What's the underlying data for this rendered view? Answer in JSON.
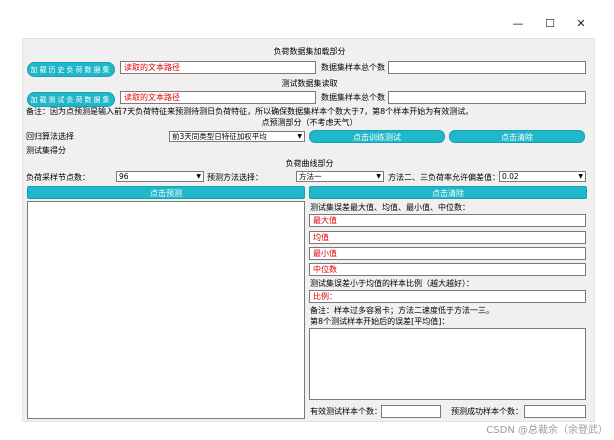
{
  "titlebar": {
    "minimize": "—",
    "maximize": "☐",
    "close": "✕"
  },
  "load_section": {
    "title": "负荷数据集加载部分",
    "load_history_button": "加载历史负荷数据集",
    "history_path": "读取的文本路径",
    "count_label": "数据集样本总个数",
    "count_value": ""
  },
  "test_section": {
    "title": "测试数据集读取",
    "load_test_button": "加载测试负荷数据集",
    "test_path": "读取的文本路径",
    "count_label": "数据集样本总个数",
    "count_value": ""
  },
  "note": "备注：因为点预测是输入前7天负荷特征来预测待测日负荷特征，所以确保数据集样本个数大于7，第8个样本开始为有效测试。",
  "point_section": {
    "title": "点预测部分（不考虑天气）",
    "algo_label": "回归算法选择",
    "algo_value": "前3天同类型日特征加权平均",
    "train_test_button": "点击训练测试",
    "clear_button": "点击清除",
    "score_label": "测试集得分"
  },
  "curve_section": {
    "title": "负荷曲线部分",
    "sample_points_label": "负荷采样节点数：",
    "sample_points_value": "96",
    "method_label": "预测方法选择：",
    "method_value": "方法一",
    "tolerance_label": "方法二、三负荷率允许偏差值：",
    "tolerance_value": "0.02",
    "predict_button": "点击预测",
    "clear_button": "点击清除"
  },
  "stats": {
    "header": "测试集误差最大值、均值、最小值、中位数：",
    "max": "最大值",
    "mean": "均值",
    "min": "最小值",
    "median": "中位数",
    "ratio_label": "测试集误差小于均值的样本比例（越大越好）：",
    "ratio": "比例：",
    "note": "备注：样本过多容易卡；方法二速度低于方法一三。",
    "from8_label": "第8个测试样本开始后的误差[平均值]：",
    "valid_count_label": "有效测试样本个数：",
    "valid_count_value": "",
    "success_count_label": "预测成功样本个数：",
    "success_count_value": ""
  },
  "watermark": "CSDN @总裁余（余登武）",
  "colors": {
    "button": "#1fb7c9",
    "error_text": "#e00000",
    "panel": "#f0f0f0"
  }
}
